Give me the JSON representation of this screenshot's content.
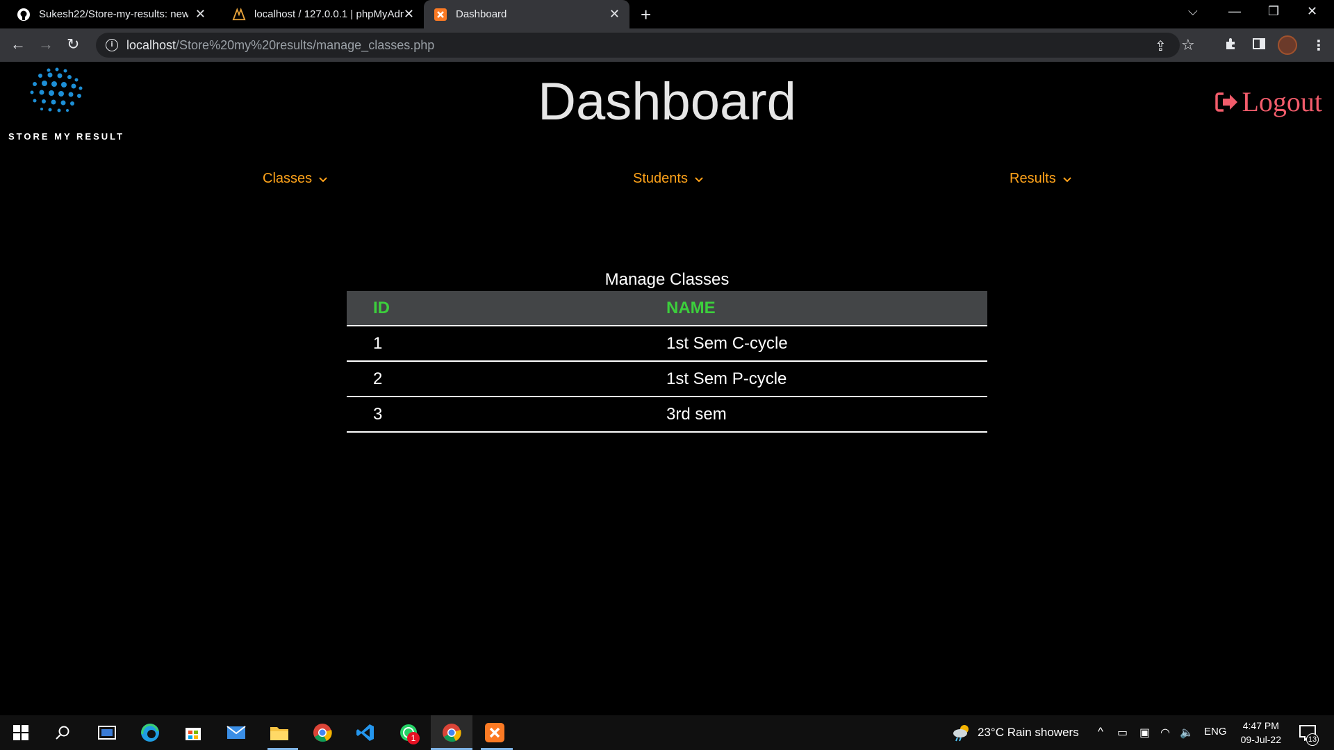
{
  "browser": {
    "tabs": [
      {
        "title": "Sukesh22/Store-my-results: new",
        "icon": "github-icon"
      },
      {
        "title": "localhost / 127.0.0.1 | phpMyAdm",
        "icon": "phpmyadmin-icon"
      },
      {
        "title": "Dashboard",
        "icon": "xampp-icon",
        "active": true
      }
    ],
    "url_host": "localhost",
    "url_path": "/Store%20my%20results/manage_classes.php"
  },
  "page": {
    "logo_text": "STORE MY RESULT",
    "title": "Dashboard",
    "logout_label": "Logout",
    "menus": [
      {
        "label": "Classes"
      },
      {
        "label": "Students"
      },
      {
        "label": "Results"
      }
    ],
    "table": {
      "caption": "Manage Classes",
      "headers": [
        "ID",
        "NAME"
      ],
      "rows": [
        {
          "id": "1",
          "name": "1st Sem C-cycle"
        },
        {
          "id": "2",
          "name": "1st Sem P-cycle"
        },
        {
          "id": "3",
          "name": "3rd sem"
        }
      ]
    },
    "colors": {
      "accent_menu": "#ffa31a",
      "header_text": "#3ccf3c",
      "logout": "#f25c6b"
    }
  },
  "taskbar": {
    "weather": "23°C  Rain showers",
    "lang": "ENG",
    "time": "4:47 PM",
    "date": "09-Jul-22",
    "whatsapp_badge": "1",
    "notifications": "13"
  }
}
